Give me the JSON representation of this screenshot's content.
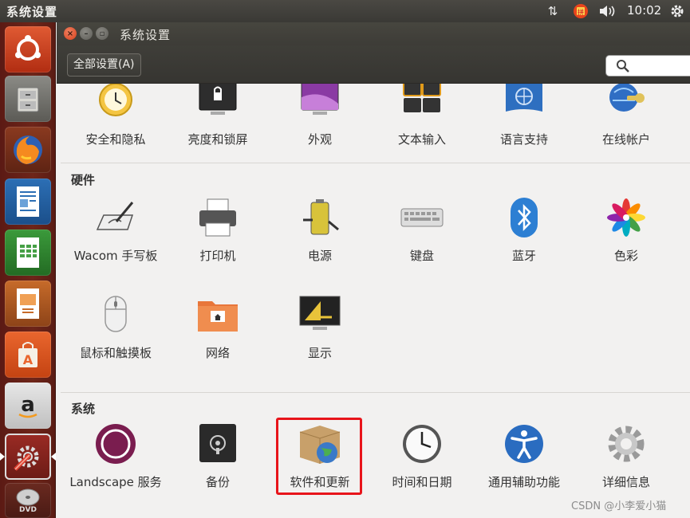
{
  "top_panel": {
    "title": "系统设置",
    "clock": "10:02"
  },
  "window": {
    "title": "系统设置",
    "all_settings_button": "全部设置(A)",
    "search_placeholder": ""
  },
  "sections": {
    "personal": {
      "items": [
        "安全和隐私",
        "亮度和锁屏",
        "外观",
        "文本输入",
        "语言支持",
        "在线帐户"
      ]
    },
    "hardware": {
      "title": "硬件",
      "items": [
        "Wacom 手写板",
        "打印机",
        "电源",
        "键盘",
        "蓝牙",
        "色彩",
        "鼠标和触摸板",
        "网络",
        "显示"
      ]
    },
    "system": {
      "title": "系统",
      "items": [
        "Landscape 服务",
        "备份",
        "软件和更新",
        "时间和日期",
        "通用辅助功能",
        "详细信息"
      ]
    }
  },
  "launcher": [
    "dash-home",
    "files",
    "firefox",
    "libreoffice-writer",
    "libreoffice-calc",
    "libreoffice-impress",
    "ubuntu-software",
    "amazon",
    "system-settings",
    "dvd"
  ],
  "watermark": "CSDN @小李爱小猫",
  "colors": {
    "launcher_bg": "#6e2519",
    "panel_bg": "#3c3b37",
    "highlight": "#e8141a",
    "accent": "#e95420"
  }
}
